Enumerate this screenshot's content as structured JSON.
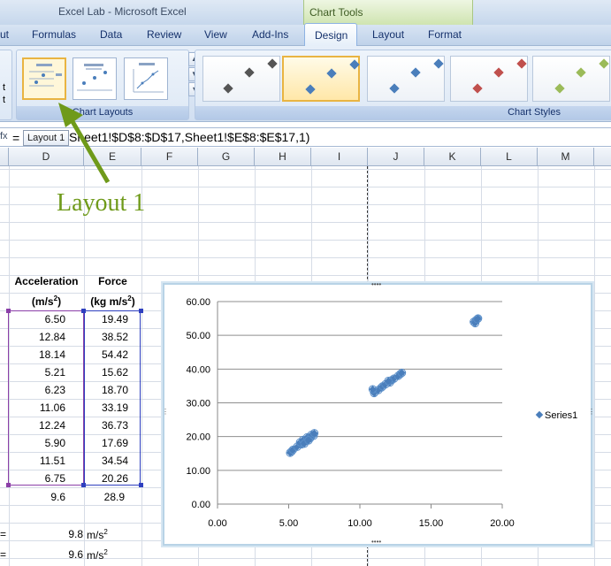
{
  "window": {
    "title": "Excel Lab - Microsoft Excel",
    "contextual_tab": "Chart Tools"
  },
  "tabs": [
    {
      "label": "ut"
    },
    {
      "label": "Formulas"
    },
    {
      "label": "Data"
    },
    {
      "label": "Review"
    },
    {
      "label": "View"
    },
    {
      "label": "Add-Ins"
    },
    {
      "label": "Design"
    },
    {
      "label": "Layout"
    },
    {
      "label": "Format"
    }
  ],
  "ribbon": {
    "left_cut_text": [
      "t",
      "t"
    ],
    "chart_layouts_label": "Chart Layouts",
    "chart_styles_label": "Chart Styles",
    "selected_layout_tooltip": "Layout 1",
    "style_colors": [
      "#555555",
      "#4a7ebb",
      "#4a7ebb",
      "#c0504d",
      "#9bbb59"
    ]
  },
  "formula_bar": {
    "fx": "fx",
    "equals": "=",
    "formula": "=SERIES(,Sheet1!$D$8:$D$17,Sheet1!$E$8:$E$17,1)",
    "visible_formula": "Sheet1!$D$8:$D$17,Sheet1!$E$8:$E$17,1)"
  },
  "columns": [
    "D",
    "E",
    "F",
    "G",
    "H",
    "I",
    "J",
    "K",
    "L",
    "M"
  ],
  "callout": {
    "text": "Layout 1",
    "color": "#6f9a1a"
  },
  "table": {
    "headers": {
      "acc_line1": "Acceleration",
      "acc_line2": "(m/s",
      "acc_line2_sup": "2",
      "acc_line2_end": ")",
      "force_line1": "Force",
      "force_line2": "(kg m/s",
      "force_line2_sup": "2",
      "force_line2_end": ")"
    },
    "rows": [
      [
        "6.50",
        "19.49"
      ],
      [
        "12.84",
        "38.52"
      ],
      [
        "18.14",
        "54.42"
      ],
      [
        "5.21",
        "15.62"
      ],
      [
        "6.23",
        "18.70"
      ],
      [
        "11.06",
        "33.19"
      ],
      [
        "12.24",
        "36.73"
      ],
      [
        "5.90",
        "17.69"
      ],
      [
        "11.51",
        "34.54"
      ],
      [
        "6.75",
        "20.26"
      ]
    ],
    "averages": [
      "9.6",
      "28.9"
    ],
    "extra": [
      {
        "label": "=",
        "value": "9.8",
        "unit": "m/s",
        "sup": "2"
      },
      {
        "label": "=",
        "value": "9.6",
        "unit": "m/s",
        "sup": "2"
      }
    ]
  },
  "chart_data": {
    "type": "scatter",
    "series": [
      {
        "name": "Series1",
        "points": [
          [
            6.5,
            19.49
          ],
          [
            12.84,
            38.52
          ],
          [
            18.14,
            54.42
          ],
          [
            5.21,
            15.62
          ],
          [
            6.23,
            18.7
          ],
          [
            11.06,
            33.19
          ],
          [
            12.24,
            36.73
          ],
          [
            5.9,
            17.69
          ],
          [
            11.51,
            34.54
          ],
          [
            6.75,
            20.26
          ],
          [
            5.1,
            15.2
          ],
          [
            5.3,
            16.1
          ],
          [
            5.6,
            17.0
          ],
          [
            5.8,
            18.3
          ],
          [
            6.0,
            19.0
          ],
          [
            6.3,
            19.8
          ],
          [
            6.6,
            20.5
          ],
          [
            6.8,
            21.0
          ],
          [
            6.1,
            17.9
          ],
          [
            6.4,
            18.9
          ],
          [
            11.0,
            32.9
          ],
          [
            11.3,
            33.8
          ],
          [
            11.6,
            34.9
          ],
          [
            11.8,
            35.5
          ],
          [
            12.1,
            36.0
          ],
          [
            12.4,
            37.2
          ],
          [
            12.7,
            38.0
          ],
          [
            12.95,
            38.9
          ],
          [
            10.9,
            34.0
          ],
          [
            12.0,
            36.5
          ],
          [
            18.0,
            54.0
          ],
          [
            18.3,
            55.0
          ],
          [
            18.1,
            53.6
          ],
          [
            18.25,
            54.8
          ]
        ],
        "color": "#4a7ebb"
      }
    ],
    "xlim": [
      0,
      20
    ],
    "ylim": [
      0,
      60
    ],
    "x_ticks": [
      "0.00",
      "5.00",
      "10.00",
      "15.00",
      "20.00"
    ],
    "y_ticks": [
      "0.00",
      "10.00",
      "20.00",
      "30.00",
      "40.00",
      "50.00",
      "60.00"
    ],
    "grid": "horizontal",
    "legend": "right"
  }
}
